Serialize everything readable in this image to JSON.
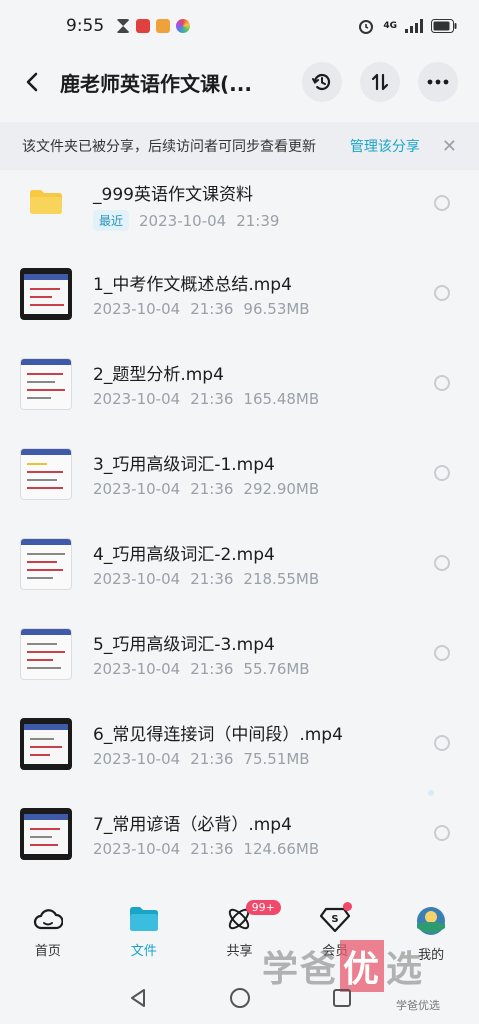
{
  "status_bar": {
    "time": "9:55",
    "network": "4G"
  },
  "header": {
    "title": "鹿老师英语作文课(...",
    "back_icon": "chevron-left-icon",
    "history_icon": "history-icon",
    "sort_icon": "sort-icon",
    "more_icon": "more-icon"
  },
  "share_banner": {
    "text": "该文件夹已被分享，后续访问者可同步查看更新",
    "manage_label": "管理该分享",
    "close_symbol": "✕"
  },
  "files": [
    {
      "name": "_999英语作文课资料",
      "badge": "最近",
      "date": "2023-10-04",
      "time": "21:39",
      "size": "",
      "kind": "folder"
    },
    {
      "name": "1_中考作文概述总结.mp4",
      "date": "2023-10-04",
      "time": "21:36",
      "size": "96.53MB",
      "kind": "video-dark"
    },
    {
      "name": "2_题型分析.mp4",
      "date": "2023-10-04",
      "time": "21:36",
      "size": "165.48MB",
      "kind": "video-light"
    },
    {
      "name": "3_巧用高级词汇-1.mp4",
      "date": "2023-10-04",
      "time": "21:36",
      "size": "292.90MB",
      "kind": "video-light"
    },
    {
      "name": "4_巧用高级词汇-2.mp4",
      "date": "2023-10-04",
      "time": "21:36",
      "size": "218.55MB",
      "kind": "video-light"
    },
    {
      "name": "5_巧用高级词汇-3.mp4",
      "date": "2023-10-04",
      "time": "21:36",
      "size": "55.76MB",
      "kind": "video-light"
    },
    {
      "name": "6_常见得连接词（中间段）.mp4",
      "date": "2023-10-04",
      "time": "21:36",
      "size": "75.51MB",
      "kind": "video-dark"
    },
    {
      "name": "7_常用谚语（必背）.mp4",
      "date": "2023-10-04",
      "time": "21:36",
      "size": "124.66MB",
      "kind": "video-dark"
    }
  ],
  "tabs": [
    {
      "label": "首页",
      "icon": "cloud-home-icon"
    },
    {
      "label": "文件",
      "icon": "folder-icon",
      "active": true
    },
    {
      "label": "共享",
      "icon": "share-atom-icon",
      "badge": "99+"
    },
    {
      "label": "会员",
      "icon": "vip-diamond-icon",
      "dot": true
    },
    {
      "label": "我的",
      "icon": "avatar-icon"
    }
  ],
  "watermark": {
    "part1": "学爸",
    "part2": "优",
    "part3": "选",
    "small": "学爸优选"
  },
  "colors": {
    "accent": "#1aa5c8",
    "badge": "#f2486a",
    "folder": "#f6c843"
  }
}
